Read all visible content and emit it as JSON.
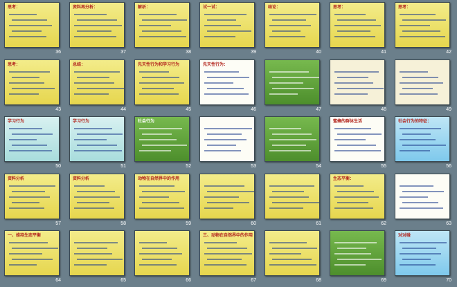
{
  "slides": [
    {
      "num": "36",
      "title": "思考：",
      "style": "g-yellow"
    },
    {
      "num": "37",
      "title": "资料再分析：",
      "style": "g-yellow"
    },
    {
      "num": "38",
      "title": "解析：",
      "style": "g-yellow"
    },
    {
      "num": "39",
      "title": "试一试：",
      "style": "g-yellow"
    },
    {
      "num": "40",
      "title": "结论：",
      "style": "g-yellow"
    },
    {
      "num": "41",
      "title": "思考：",
      "style": "g-yellow"
    },
    {
      "num": "42",
      "title": "思考：",
      "style": "g-yellow"
    },
    {
      "num": "43",
      "title": "思考：",
      "style": "g-yellow"
    },
    {
      "num": "44",
      "title": "总结：",
      "style": "g-yellow"
    },
    {
      "num": "45",
      "title": "先天性行为和学习行为",
      "style": "g-yellow"
    },
    {
      "num": "46",
      "title": "先天性行为：",
      "style": "g-white"
    },
    {
      "num": "47",
      "title": "",
      "style": "g-green"
    },
    {
      "num": "48",
      "title": "",
      "style": "g-cream"
    },
    {
      "num": "49",
      "title": "",
      "style": "g-cream"
    },
    {
      "num": "50",
      "title": "学习行为",
      "style": "g-teal"
    },
    {
      "num": "51",
      "title": "学习行为",
      "style": "g-teal"
    },
    {
      "num": "52",
      "title": "社会行为",
      "style": "g-green"
    },
    {
      "num": "53",
      "title": "",
      "style": "g-white"
    },
    {
      "num": "54",
      "title": "",
      "style": "g-green"
    },
    {
      "num": "55",
      "title": "蜜蜂的群体生活",
      "style": "g-white"
    },
    {
      "num": "56",
      "title": "社会行为的特征：",
      "style": "g-blue"
    },
    {
      "num": "57",
      "title": "资料分析",
      "style": "g-yellow"
    },
    {
      "num": "58",
      "title": "资料分析",
      "style": "g-yellow"
    },
    {
      "num": "59",
      "title": "动物在自然界中的作用",
      "style": "g-yellow"
    },
    {
      "num": "60",
      "title": "",
      "style": "g-yellow"
    },
    {
      "num": "61",
      "title": "",
      "style": "g-yellow"
    },
    {
      "num": "62",
      "title": "生态平衡：",
      "style": "g-yellow"
    },
    {
      "num": "63",
      "title": "",
      "style": "g-white"
    },
    {
      "num": "64",
      "title": "一、维持生态平衡",
      "style": "g-yellow"
    },
    {
      "num": "65",
      "title": "",
      "style": "g-yellow"
    },
    {
      "num": "66",
      "title": "",
      "style": "g-yellow"
    },
    {
      "num": "67",
      "title": "三、动物在自然界中的作用",
      "style": "g-yellow"
    },
    {
      "num": "68",
      "title": "",
      "style": "g-yellow"
    },
    {
      "num": "69",
      "title": "",
      "style": "g-green"
    },
    {
      "num": "70",
      "title": "对对碰",
      "style": "g-blue"
    }
  ],
  "text": {
    "s36": "为什么我们不能对狗随意的",
    "s37a": "1. 条件反射",
    "s37b": "2. 非条件反射",
    "s38": "动物运动时，",
    "s40": "结论：",
    "s43a": "哺乳动物运动系统",
    "s43b": "骨 关节 肌肉",
    "s44": "1. 骨在运动中起杠杆作用",
    "s46a": "先天性行为：",
    "s46b": "学习行为：",
    "s55a": "1. 蜂王：",
    "s55b": "2. 雄蜂：",
    "s55c": "3. 工蜂：",
    "s56a": "1. 群体内部往往形成一定的组织",
    "s56b": "2. 成员之间有明确的分工",
    "s56c": "3. 有的群体还形成等级制度",
    "s62": "生态平衡：",
    "s64": "一、维持生态平衡",
    "s67": "三、动物在自然界中的作用"
  }
}
